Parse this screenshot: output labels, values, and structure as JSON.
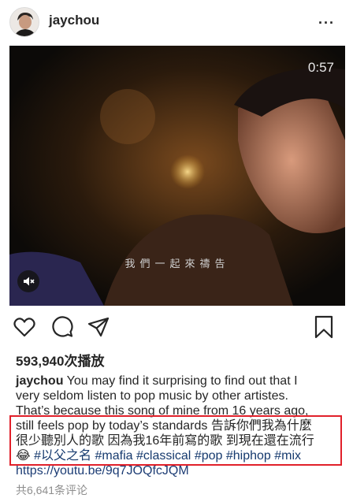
{
  "post": {
    "username": "jaychou",
    "more_icon": "..."
  },
  "video": {
    "time": "0:57",
    "subtitle": "我們一起來禱告",
    "mute_icon": "speaker-muted-icon"
  },
  "actions": {
    "like_icon": "heart-icon",
    "comment_icon": "comment-icon",
    "share_icon": "paper-plane-icon",
    "save_icon": "bookmark-icon"
  },
  "likes": "593,940次播放",
  "caption": {
    "username": "jaychou",
    "line1": " You may find it surprising to find out that I",
    "line2": "very seldom listen to pop music by other artistes.",
    "line3": "That’s because this song of mine from 16 years ago,",
    "line4": "still feels pop by today’s standards 告訴你們我為什麼",
    "line5": "很少聽別人的歌 因為我16年前寫的歌 到現在還在流行",
    "emoji": "😂",
    "tags": [
      "#以父之名",
      "#mafia",
      "#classical",
      "#pop",
      "#hiphop",
      "#mix"
    ],
    "link": "https://youtu.be/9q7JOQfcJQM"
  },
  "comments": "共6,641条评论",
  "colors": {
    "highlight": "#e1202a",
    "hashtag": "#163a6e"
  }
}
